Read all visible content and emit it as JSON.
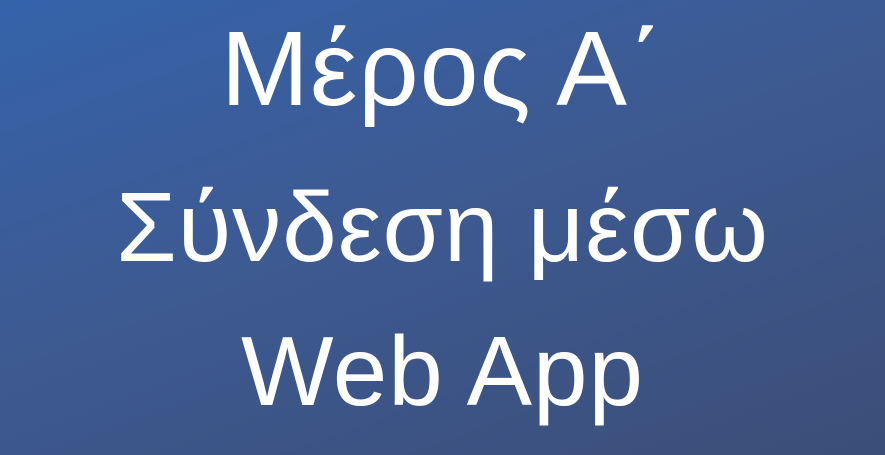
{
  "slide": {
    "title": "Μέρος Α΄",
    "subtitle_line1": "Σύνδεση μέσω",
    "subtitle_line2": "Web App",
    "background_colors": [
      "#3563ab",
      "#3d5a92",
      "#3b4e78"
    ],
    "text_color": "#ffffff"
  }
}
